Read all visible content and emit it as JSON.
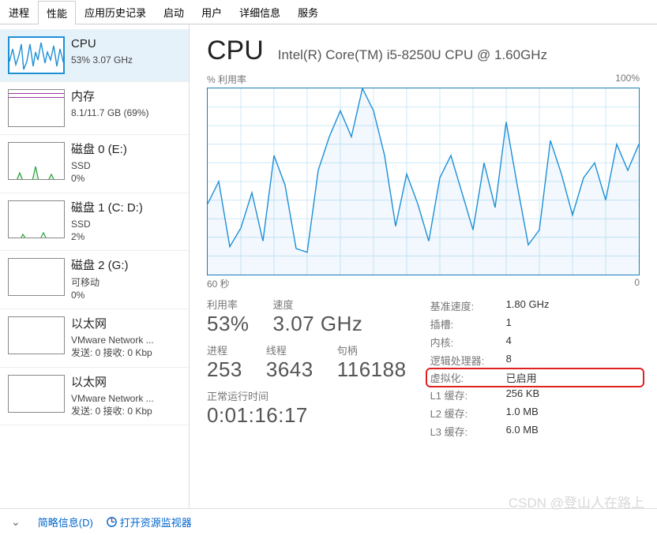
{
  "tabs": [
    "进程",
    "性能",
    "应用历史记录",
    "启动",
    "用户",
    "详细信息",
    "服务"
  ],
  "active_tab_index": 1,
  "sidebar": {
    "items": [
      {
        "title": "CPU",
        "sub": "53%  3.07 GHz",
        "sub2": ""
      },
      {
        "title": "内存",
        "sub": "8.1/11.7 GB (69%)",
        "sub2": ""
      },
      {
        "title": "磁盘 0 (E:)",
        "sub": "SSD",
        "sub2": "0%"
      },
      {
        "title": "磁盘 1 (C: D:)",
        "sub": "SSD",
        "sub2": "2%"
      },
      {
        "title": "磁盘 2 (G:)",
        "sub": "可移动",
        "sub2": "0%"
      },
      {
        "title": "以太网",
        "sub": "VMware Network ...",
        "sub2": "发送: 0  接收: 0 Kbp"
      },
      {
        "title": "以太网",
        "sub": "VMware Network ...",
        "sub2": "发送: 0  接收: 0 Kbp"
      }
    ],
    "active_index": 0
  },
  "header": {
    "title": "CPU",
    "subtitle": "Intel(R) Core(TM) i5-8250U CPU @ 1.60GHz"
  },
  "chart_axis": {
    "top_left": "% 利用率",
    "top_right": "100%",
    "bottom_left": "60 秒",
    "bottom_right": "0"
  },
  "stats_left": {
    "utilization": {
      "label": "利用率",
      "value": "53%"
    },
    "speed": {
      "label": "速度",
      "value": "3.07 GHz"
    },
    "processes": {
      "label": "进程",
      "value": "253"
    },
    "threads": {
      "label": "线程",
      "value": "3643"
    },
    "handles": {
      "label": "句柄",
      "value": "116188"
    },
    "uptime": {
      "label": "正常运行时间",
      "value": "0:01:16:17"
    }
  },
  "stats_right": [
    {
      "label": "基准速度:",
      "value": "1.80 GHz",
      "hl": false
    },
    {
      "label": "插槽:",
      "value": "1",
      "hl": false
    },
    {
      "label": "内核:",
      "value": "4",
      "hl": false
    },
    {
      "label": "逻辑处理器:",
      "value": "8",
      "hl": false
    },
    {
      "label": "虚拟化:",
      "value": "已启用",
      "hl": true
    },
    {
      "label": "L1 缓存:",
      "value": "256 KB",
      "hl": false
    },
    {
      "label": "L2 缓存:",
      "value": "1.0 MB",
      "hl": false
    },
    {
      "label": "L3 缓存:",
      "value": "6.0 MB",
      "hl": false
    }
  ],
  "footer": {
    "brief": "简略信息(D)",
    "resmon": "打开资源监视器"
  },
  "watermark": "CSDN @登山人在路上",
  "chart_data": {
    "type": "line",
    "x_range_seconds": 60,
    "y_range_percent": [
      0,
      100
    ],
    "title": "% 利用率",
    "series": [
      {
        "name": "CPU利用率",
        "values_percent": [
          38,
          50,
          15,
          25,
          44,
          18,
          64,
          48,
          14,
          12,
          56,
          74,
          88,
          74,
          100,
          88,
          64,
          26,
          54,
          38,
          18,
          52,
          64,
          44,
          24,
          60,
          36,
          82,
          48,
          16,
          24,
          72,
          54,
          32,
          52,
          60,
          40,
          70,
          56,
          70
        ]
      }
    ]
  }
}
